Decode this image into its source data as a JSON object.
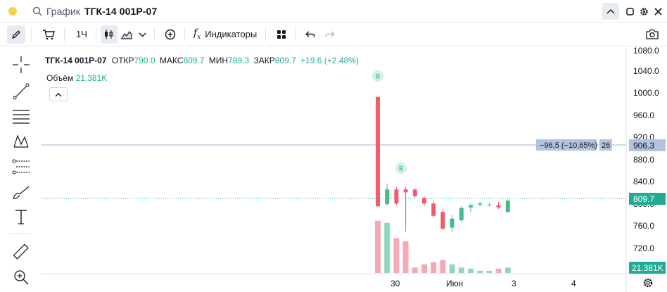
{
  "window": {
    "title_label": "График",
    "symbol": "ТГК-14 001Р-07"
  },
  "toolbar": {
    "interval": "1Ч",
    "indicators_label": "Индикаторы"
  },
  "legend": {
    "symbol": "ТГК-14 001Р-07",
    "open_label": "ОТКР",
    "open_value": "790.0",
    "high_label": "МАКС",
    "high_value": "809.7",
    "low_label": "МИН",
    "low_value": "789.3",
    "close_label": "ЗАКР",
    "close_value": "809.7",
    "change": "+19.6 (+2.48%)",
    "volume_label": "Объём",
    "volume_value": "21.381K"
  },
  "measure": {
    "text": "−96,5 (−10,65%)",
    "bars": "26",
    "price": "906.3"
  },
  "price_scale": {
    "ticks": [
      "1080.0",
      "1040.0",
      "1000.0",
      "960.0",
      "920.0",
      "880.0",
      "840.0",
      "800.0",
      "760.0",
      "720.0"
    ],
    "last_price": "809.7",
    "last_volume": "21.381K"
  },
  "time_scale": {
    "ticks": [
      "30",
      "Июн",
      "3",
      "4"
    ]
  },
  "markers": [
    "B",
    "B"
  ],
  "colors": {
    "up": "#3ebd8e",
    "down": "#f05c6e",
    "vol_up": "#8fd8bb",
    "vol_down": "#f5a9b4",
    "accent": "#2962ff",
    "measure_bg": "#b2c3de",
    "last_price_bg": "#22ab94"
  },
  "chart_data": {
    "type": "candlestick",
    "ylim": [
      680,
      1090
    ],
    "candles": [
      {
        "o": 995,
        "h": 995,
        "l": 800,
        "c": 800
      },
      {
        "o": 804,
        "h": 840,
        "l": 800,
        "c": 830
      },
      {
        "o": 830,
        "h": 835,
        "l": 802,
        "c": 805
      },
      {
        "o": 830,
        "h": 835,
        "l": 755,
        "c": 825
      },
      {
        "o": 830,
        "h": 832,
        "l": 815,
        "c": 818
      },
      {
        "o": 815,
        "h": 818,
        "l": 800,
        "c": 805
      },
      {
        "o": 805,
        "h": 810,
        "l": 780,
        "c": 783
      },
      {
        "o": 790,
        "h": 795,
        "l": 758,
        "c": 760
      },
      {
        "o": 762,
        "h": 785,
        "l": 755,
        "c": 778
      },
      {
        "o": 775,
        "h": 800,
        "l": 772,
        "c": 797
      },
      {
        "o": 798,
        "h": 805,
        "l": 790,
        "c": 802
      },
      {
        "o": 803,
        "h": 808,
        "l": 800,
        "c": 805
      },
      {
        "o": 803,
        "h": 806,
        "l": 800,
        "c": 803
      },
      {
        "o": 802,
        "h": 808,
        "l": 795,
        "c": 798
      },
      {
        "o": 790,
        "h": 812,
        "l": 789,
        "c": 810
      }
    ],
    "volume": [
      48,
      46,
      32,
      29,
      5,
      8,
      10,
      12,
      8,
      5,
      4,
      2,
      2,
      4,
      5
    ],
    "measure_price": 906.3,
    "last_price": 809.7
  }
}
